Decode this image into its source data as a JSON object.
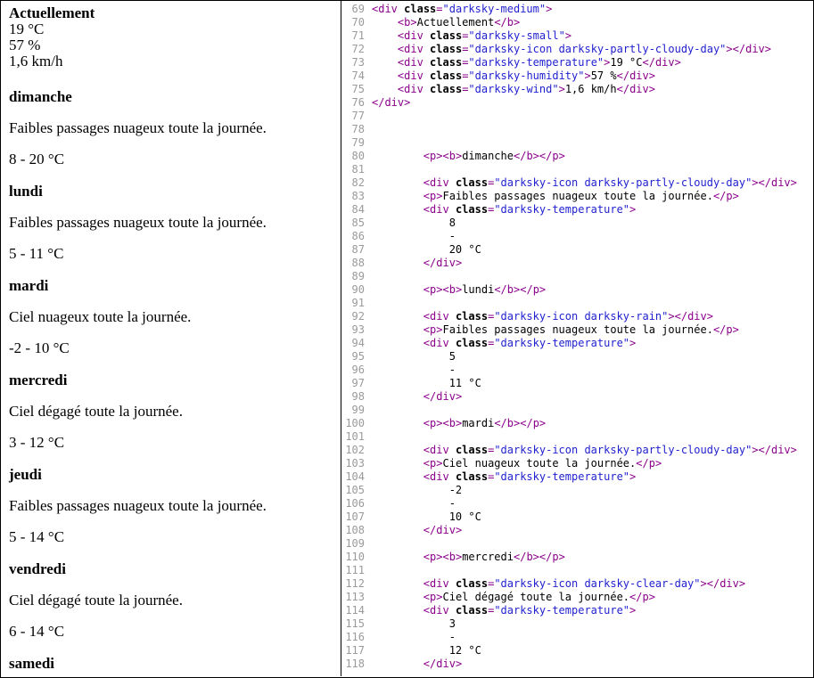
{
  "preview": {
    "current": {
      "heading": "Actuellement",
      "temperature": "19 °C",
      "humidity": "57 %",
      "wind": "1,6 km/h"
    },
    "days": [
      {
        "name": "dimanche",
        "summary": "Faibles passages nuageux toute la journée.",
        "temps": "8 - 20 °C"
      },
      {
        "name": "lundi",
        "summary": "Faibles passages nuageux toute la journée.",
        "temps": "5 - 11 °C"
      },
      {
        "name": "mardi",
        "summary": "Ciel nuageux toute la journée.",
        "temps": "-2 - 10 °C"
      },
      {
        "name": "mercredi",
        "summary": "Ciel dégagé toute la journée.",
        "temps": "3 - 12 °C"
      },
      {
        "name": "jeudi",
        "summary": "Faibles passages nuageux toute la journée.",
        "temps": "5 - 14 °C"
      },
      {
        "name": "vendredi",
        "summary": "Ciel dégagé toute la journée.",
        "temps": "6 - 14 °C"
      },
      {
        "name": "samedi",
        "summary": "",
        "temps": ""
      }
    ]
  },
  "code": {
    "lines": [
      {
        "n": "69",
        "segs": [
          [
            "t",
            "<"
          ],
          [
            "g",
            "div"
          ],
          [
            "a",
            " class"
          ],
          [
            "t",
            "="
          ],
          [
            "s",
            "\"darksky-medium\""
          ],
          [
            "t",
            ">"
          ]
        ]
      },
      {
        "n": "70",
        "segs": [
          [
            "x",
            "    "
          ],
          [
            "t",
            "<"
          ],
          [
            "g",
            "b"
          ],
          [
            "t",
            ">"
          ],
          [
            "x",
            "Actuellement"
          ],
          [
            "t",
            "</"
          ],
          [
            "g",
            "b"
          ],
          [
            "t",
            ">"
          ]
        ]
      },
      {
        "n": "71",
        "segs": [
          [
            "x",
            "    "
          ],
          [
            "t",
            "<"
          ],
          [
            "g",
            "div"
          ],
          [
            "a",
            " class"
          ],
          [
            "t",
            "="
          ],
          [
            "s",
            "\"darksky-small\""
          ],
          [
            "t",
            ">"
          ]
        ]
      },
      {
        "n": "72",
        "segs": [
          [
            "x",
            "    "
          ],
          [
            "t",
            "<"
          ],
          [
            "g",
            "div"
          ],
          [
            "a",
            " class"
          ],
          [
            "t",
            "="
          ],
          [
            "s",
            "\"darksky-icon darksky-partly-cloudy-day\""
          ],
          [
            "t",
            ">"
          ],
          [
            "t",
            "</"
          ],
          [
            "g",
            "div"
          ],
          [
            "t",
            ">"
          ]
        ]
      },
      {
        "n": "73",
        "segs": [
          [
            "x",
            "    "
          ],
          [
            "t",
            "<"
          ],
          [
            "g",
            "div"
          ],
          [
            "a",
            " class"
          ],
          [
            "t",
            "="
          ],
          [
            "s",
            "\"darksky-temperature\""
          ],
          [
            "t",
            ">"
          ],
          [
            "x",
            "19 °C"
          ],
          [
            "t",
            "</"
          ],
          [
            "g",
            "div"
          ],
          [
            "t",
            ">"
          ]
        ]
      },
      {
        "n": "74",
        "segs": [
          [
            "x",
            "    "
          ],
          [
            "t",
            "<"
          ],
          [
            "g",
            "div"
          ],
          [
            "a",
            " class"
          ],
          [
            "t",
            "="
          ],
          [
            "s",
            "\"darksky-humidity\""
          ],
          [
            "t",
            ">"
          ],
          [
            "x",
            "57 %"
          ],
          [
            "t",
            "</"
          ],
          [
            "g",
            "div"
          ],
          [
            "t",
            ">"
          ]
        ]
      },
      {
        "n": "75",
        "segs": [
          [
            "x",
            "    "
          ],
          [
            "t",
            "<"
          ],
          [
            "g",
            "div"
          ],
          [
            "a",
            " class"
          ],
          [
            "t",
            "="
          ],
          [
            "s",
            "\"darksky-wind\""
          ],
          [
            "t",
            ">"
          ],
          [
            "x",
            "1,6 km/h"
          ],
          [
            "t",
            "</"
          ],
          [
            "g",
            "div"
          ],
          [
            "t",
            ">"
          ]
        ]
      },
      {
        "n": "76",
        "segs": [
          [
            "t",
            "</"
          ],
          [
            "g",
            "div"
          ],
          [
            "t",
            ">"
          ]
        ]
      },
      {
        "n": "77",
        "segs": []
      },
      {
        "n": "78",
        "segs": []
      },
      {
        "n": "79",
        "segs": []
      },
      {
        "n": "80",
        "segs": [
          [
            "x",
            "        "
          ],
          [
            "t",
            "<"
          ],
          [
            "g",
            "p"
          ],
          [
            "t",
            "><"
          ],
          [
            "g",
            "b"
          ],
          [
            "t",
            ">"
          ],
          [
            "x",
            "dimanche"
          ],
          [
            "t",
            "</"
          ],
          [
            "g",
            "b"
          ],
          [
            "t",
            "></"
          ],
          [
            "g",
            "p"
          ],
          [
            "t",
            ">"
          ]
        ]
      },
      {
        "n": "81",
        "segs": []
      },
      {
        "n": "82",
        "segs": [
          [
            "x",
            "        "
          ],
          [
            "t",
            "<"
          ],
          [
            "g",
            "div"
          ],
          [
            "a",
            " class"
          ],
          [
            "t",
            "="
          ],
          [
            "s",
            "\"darksky-icon darksky-partly-cloudy-day\""
          ],
          [
            "t",
            ">"
          ],
          [
            "t",
            "</"
          ],
          [
            "g",
            "div"
          ],
          [
            "t",
            ">"
          ]
        ]
      },
      {
        "n": "83",
        "segs": [
          [
            "x",
            "        "
          ],
          [
            "t",
            "<"
          ],
          [
            "g",
            "p"
          ],
          [
            "t",
            ">"
          ],
          [
            "x",
            "Faibles passages nuageux toute la journée."
          ],
          [
            "t",
            "</"
          ],
          [
            "g",
            "p"
          ],
          [
            "t",
            ">"
          ]
        ]
      },
      {
        "n": "84",
        "segs": [
          [
            "x",
            "        "
          ],
          [
            "t",
            "<"
          ],
          [
            "g",
            "div"
          ],
          [
            "a",
            " class"
          ],
          [
            "t",
            "="
          ],
          [
            "s",
            "\"darksky-temperature\""
          ],
          [
            "t",
            ">"
          ]
        ]
      },
      {
        "n": "85",
        "segs": [
          [
            "x",
            "            8"
          ]
        ]
      },
      {
        "n": "86",
        "segs": [
          [
            "x",
            "            -"
          ]
        ]
      },
      {
        "n": "87",
        "segs": [
          [
            "x",
            "            20 °C"
          ]
        ]
      },
      {
        "n": "88",
        "segs": [
          [
            "x",
            "        "
          ],
          [
            "t",
            "</"
          ],
          [
            "g",
            "div"
          ],
          [
            "t",
            ">"
          ]
        ]
      },
      {
        "n": "89",
        "segs": []
      },
      {
        "n": "90",
        "segs": [
          [
            "x",
            "        "
          ],
          [
            "t",
            "<"
          ],
          [
            "g",
            "p"
          ],
          [
            "t",
            "><"
          ],
          [
            "g",
            "b"
          ],
          [
            "t",
            ">"
          ],
          [
            "x",
            "lundi"
          ],
          [
            "t",
            "</"
          ],
          [
            "g",
            "b"
          ],
          [
            "t",
            "></"
          ],
          [
            "g",
            "p"
          ],
          [
            "t",
            ">"
          ]
        ]
      },
      {
        "n": "91",
        "segs": []
      },
      {
        "n": "92",
        "segs": [
          [
            "x",
            "        "
          ],
          [
            "t",
            "<"
          ],
          [
            "g",
            "div"
          ],
          [
            "a",
            " class"
          ],
          [
            "t",
            "="
          ],
          [
            "s",
            "\"darksky-icon darksky-rain\""
          ],
          [
            "t",
            ">"
          ],
          [
            "t",
            "</"
          ],
          [
            "g",
            "div"
          ],
          [
            "t",
            ">"
          ]
        ]
      },
      {
        "n": "93",
        "segs": [
          [
            "x",
            "        "
          ],
          [
            "t",
            "<"
          ],
          [
            "g",
            "p"
          ],
          [
            "t",
            ">"
          ],
          [
            "x",
            "Faibles passages nuageux toute la journée."
          ],
          [
            "t",
            "</"
          ],
          [
            "g",
            "p"
          ],
          [
            "t",
            ">"
          ]
        ]
      },
      {
        "n": "94",
        "segs": [
          [
            "x",
            "        "
          ],
          [
            "t",
            "<"
          ],
          [
            "g",
            "div"
          ],
          [
            "a",
            " class"
          ],
          [
            "t",
            "="
          ],
          [
            "s",
            "\"darksky-temperature\""
          ],
          [
            "t",
            ">"
          ]
        ]
      },
      {
        "n": "95",
        "segs": [
          [
            "x",
            "            5"
          ]
        ]
      },
      {
        "n": "96",
        "segs": [
          [
            "x",
            "            -"
          ]
        ]
      },
      {
        "n": "97",
        "segs": [
          [
            "x",
            "            11 °C"
          ]
        ]
      },
      {
        "n": "98",
        "segs": [
          [
            "x",
            "        "
          ],
          [
            "t",
            "</"
          ],
          [
            "g",
            "div"
          ],
          [
            "t",
            ">"
          ]
        ]
      },
      {
        "n": "99",
        "segs": []
      },
      {
        "n": "100",
        "segs": [
          [
            "x",
            "        "
          ],
          [
            "t",
            "<"
          ],
          [
            "g",
            "p"
          ],
          [
            "t",
            "><"
          ],
          [
            "g",
            "b"
          ],
          [
            "t",
            ">"
          ],
          [
            "x",
            "mardi"
          ],
          [
            "t",
            "</"
          ],
          [
            "g",
            "b"
          ],
          [
            "t",
            "></"
          ],
          [
            "g",
            "p"
          ],
          [
            "t",
            ">"
          ]
        ]
      },
      {
        "n": "101",
        "segs": []
      },
      {
        "n": "102",
        "segs": [
          [
            "x",
            "        "
          ],
          [
            "t",
            "<"
          ],
          [
            "g",
            "div"
          ],
          [
            "a",
            " class"
          ],
          [
            "t",
            "="
          ],
          [
            "s",
            "\"darksky-icon darksky-partly-cloudy-day\""
          ],
          [
            "t",
            ">"
          ],
          [
            "t",
            "</"
          ],
          [
            "g",
            "div"
          ],
          [
            "t",
            ">"
          ]
        ]
      },
      {
        "n": "103",
        "segs": [
          [
            "x",
            "        "
          ],
          [
            "t",
            "<"
          ],
          [
            "g",
            "p"
          ],
          [
            "t",
            ">"
          ],
          [
            "x",
            "Ciel nuageux toute la journée."
          ],
          [
            "t",
            "</"
          ],
          [
            "g",
            "p"
          ],
          [
            "t",
            ">"
          ]
        ]
      },
      {
        "n": "104",
        "segs": [
          [
            "x",
            "        "
          ],
          [
            "t",
            "<"
          ],
          [
            "g",
            "div"
          ],
          [
            "a",
            " class"
          ],
          [
            "t",
            "="
          ],
          [
            "s",
            "\"darksky-temperature\""
          ],
          [
            "t",
            ">"
          ]
        ]
      },
      {
        "n": "105",
        "segs": [
          [
            "x",
            "            -2"
          ]
        ]
      },
      {
        "n": "106",
        "segs": [
          [
            "x",
            "            -"
          ]
        ]
      },
      {
        "n": "107",
        "segs": [
          [
            "x",
            "            10 °C"
          ]
        ]
      },
      {
        "n": "108",
        "segs": [
          [
            "x",
            "        "
          ],
          [
            "t",
            "</"
          ],
          [
            "g",
            "div"
          ],
          [
            "t",
            ">"
          ]
        ]
      },
      {
        "n": "109",
        "segs": []
      },
      {
        "n": "110",
        "segs": [
          [
            "x",
            "        "
          ],
          [
            "t",
            "<"
          ],
          [
            "g",
            "p"
          ],
          [
            "t",
            "><"
          ],
          [
            "g",
            "b"
          ],
          [
            "t",
            ">"
          ],
          [
            "x",
            "mercredi"
          ],
          [
            "t",
            "</"
          ],
          [
            "g",
            "b"
          ],
          [
            "t",
            "></"
          ],
          [
            "g",
            "p"
          ],
          [
            "t",
            ">"
          ]
        ]
      },
      {
        "n": "111",
        "segs": []
      },
      {
        "n": "112",
        "segs": [
          [
            "x",
            "        "
          ],
          [
            "t",
            "<"
          ],
          [
            "g",
            "div"
          ],
          [
            "a",
            " class"
          ],
          [
            "t",
            "="
          ],
          [
            "s",
            "\"darksky-icon darksky-clear-day\""
          ],
          [
            "t",
            ">"
          ],
          [
            "t",
            "</"
          ],
          [
            "g",
            "div"
          ],
          [
            "t",
            ">"
          ]
        ]
      },
      {
        "n": "113",
        "segs": [
          [
            "x",
            "        "
          ],
          [
            "t",
            "<"
          ],
          [
            "g",
            "p"
          ],
          [
            "t",
            ">"
          ],
          [
            "x",
            "Ciel dégagé toute la journée."
          ],
          [
            "t",
            "</"
          ],
          [
            "g",
            "p"
          ],
          [
            "t",
            ">"
          ]
        ]
      },
      {
        "n": "114",
        "segs": [
          [
            "x",
            "        "
          ],
          [
            "t",
            "<"
          ],
          [
            "g",
            "div"
          ],
          [
            "a",
            " class"
          ],
          [
            "t",
            "="
          ],
          [
            "s",
            "\"darksky-temperature\""
          ],
          [
            "t",
            ">"
          ]
        ]
      },
      {
        "n": "115",
        "segs": [
          [
            "x",
            "            3"
          ]
        ]
      },
      {
        "n": "116",
        "segs": [
          [
            "x",
            "            -"
          ]
        ]
      },
      {
        "n": "117",
        "segs": [
          [
            "x",
            "            12 °C"
          ]
        ]
      },
      {
        "n": "118",
        "segs": [
          [
            "x",
            "        "
          ],
          [
            "t",
            "</"
          ],
          [
            "g",
            "div"
          ],
          [
            "t",
            ">"
          ]
        ]
      }
    ]
  }
}
